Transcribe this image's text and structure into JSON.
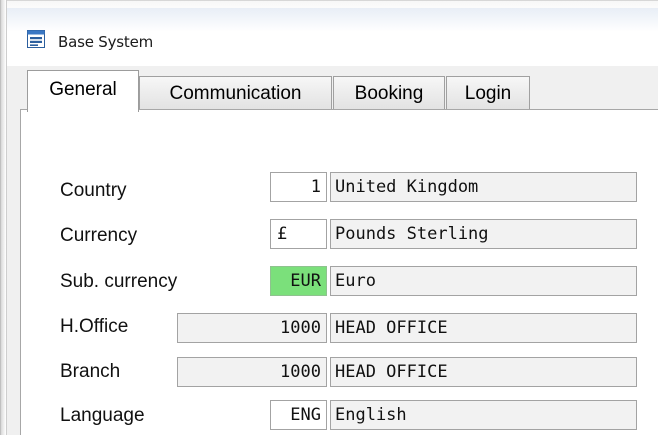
{
  "window": {
    "title": "Base System",
    "icon": "form-window-icon"
  },
  "tabs": [
    {
      "label": "General",
      "active": true
    },
    {
      "label": "Communication",
      "active": false
    },
    {
      "label": "Booking",
      "active": false
    },
    {
      "label": "Login",
      "active": false
    }
  ],
  "fields": {
    "country": {
      "label": "Country",
      "code": "1",
      "description": "United Kingdom"
    },
    "currency": {
      "label": "Currency",
      "code": "£",
      "description": "Pounds Sterling"
    },
    "sub_currency": {
      "label": "Sub. currency",
      "code": "EUR",
      "description": "Euro",
      "highlight_color": "#7be07b"
    },
    "head_office": {
      "label": "H.Office",
      "code": "1000",
      "description": "HEAD OFFICE"
    },
    "branch": {
      "label": "Branch",
      "code": "1000",
      "description": "HEAD OFFICE"
    },
    "language": {
      "label": "Language",
      "code": "ENG",
      "description": "English"
    }
  }
}
